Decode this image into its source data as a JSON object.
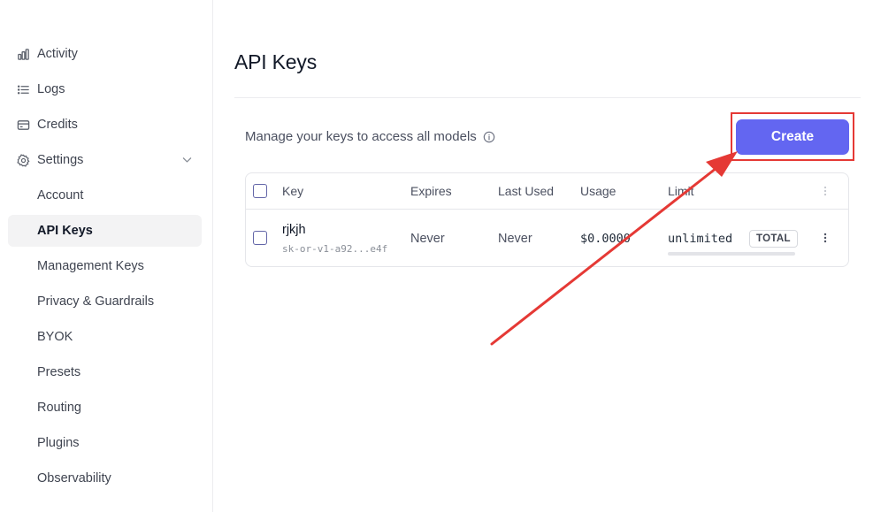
{
  "sidebar": {
    "items": [
      {
        "label": "Activity",
        "icon": "bar-chart-icon"
      },
      {
        "label": "Logs",
        "icon": "list-icon"
      },
      {
        "label": "Credits",
        "icon": "credit-card-icon"
      },
      {
        "label": "Settings",
        "icon": "gear-icon"
      }
    ],
    "settings_items": [
      {
        "label": "Account"
      },
      {
        "label": "API Keys",
        "active": true
      },
      {
        "label": "Management Keys"
      },
      {
        "label": "Privacy & Guardrails"
      },
      {
        "label": "BYOK"
      },
      {
        "label": "Presets"
      },
      {
        "label": "Routing"
      },
      {
        "label": "Plugins"
      },
      {
        "label": "Observability"
      }
    ]
  },
  "main": {
    "title": "API Keys",
    "description": "Manage your keys to access all models",
    "create_label": "Create"
  },
  "table": {
    "headers": {
      "key": "Key",
      "expires": "Expires",
      "last_used": "Last Used",
      "usage": "Usage",
      "limit": "Limit"
    },
    "rows": [
      {
        "name": "rjkjh",
        "key_id": "sk-or-v1-a92...e4f",
        "expires": "Never",
        "last_used": "Never",
        "usage": "$0.0000",
        "limit": "unlimited",
        "limit_type": "TOTAL"
      }
    ]
  },
  "colors": {
    "accent": "#6366f1",
    "annotation": "#e53935"
  }
}
